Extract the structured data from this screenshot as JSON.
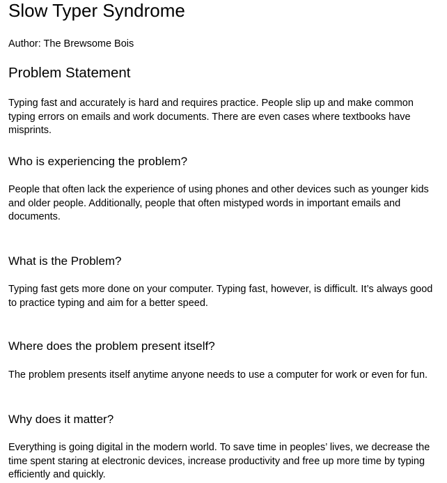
{
  "document": {
    "title": "Slow Typer Syndrome",
    "author": "Author: The Brewsome Bois",
    "problem_statement": {
      "heading": "Problem Statement",
      "text": "Typing fast and accurately is hard and requires practice. People slip up and make common typing errors on emails and work documents. There are even cases where textbooks have misprints."
    },
    "sections": [
      {
        "heading": "Who is experiencing the problem?",
        "text": "People that often lack the experience of using phones and other devices such as younger kids and older people. Additionally, people that often mistyped words in important emails and documents."
      },
      {
        "heading": "What is the Problem?",
        "text": "Typing fast gets more done on your computer. Typing fast, however, is difficult. It’s always good to practice typing and aim for a better speed."
      },
      {
        "heading": "Where does the problem present itself?",
        "text": "The problem presents itself anytime anyone needs to use a computer for work or even for fun."
      },
      {
        "heading": "Why does it matter?",
        "text": "Everything is going digital in the modern world. To save time in peoples’ lives, we decrease the time spent staring at electronic devices, increase productivity and free up more time by typing efficiently and quickly."
      }
    ]
  }
}
